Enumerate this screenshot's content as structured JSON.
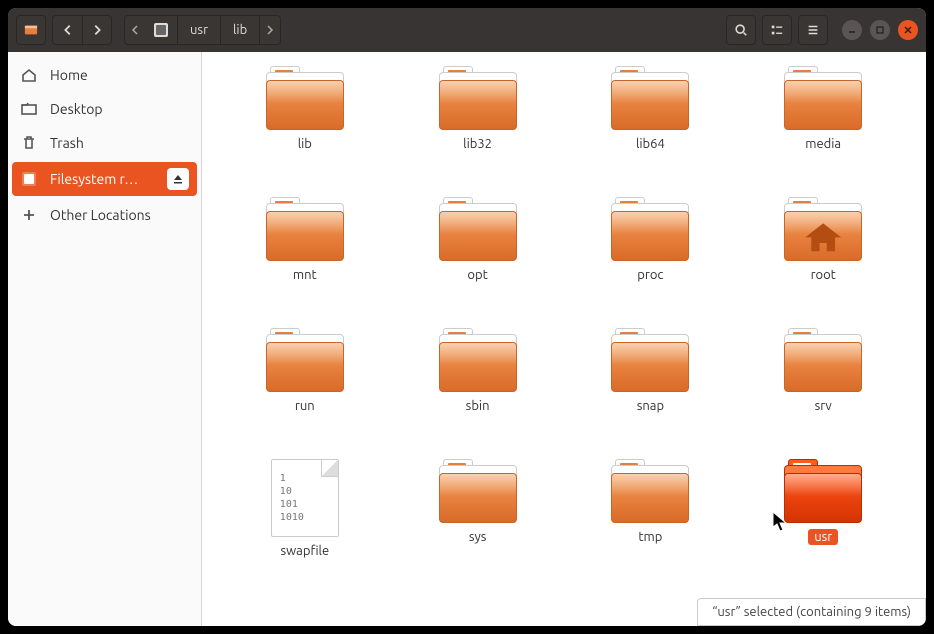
{
  "pathbar": {
    "segments": [
      "usr",
      "lib"
    ]
  },
  "sidebar": {
    "home": "Home",
    "desktop": "Desktop",
    "trash": "Trash",
    "filesystem": "Filesystem r…",
    "other": "Other Locations"
  },
  "items": [
    {
      "name": "lib",
      "type": "folder"
    },
    {
      "name": "lib32",
      "type": "folder"
    },
    {
      "name": "lib64",
      "type": "folder"
    },
    {
      "name": "media",
      "type": "folder"
    },
    {
      "name": "mnt",
      "type": "folder"
    },
    {
      "name": "opt",
      "type": "folder"
    },
    {
      "name": "proc",
      "type": "folder"
    },
    {
      "name": "root",
      "type": "folder-home"
    },
    {
      "name": "run",
      "type": "folder"
    },
    {
      "name": "sbin",
      "type": "folder"
    },
    {
      "name": "snap",
      "type": "folder"
    },
    {
      "name": "srv",
      "type": "folder"
    },
    {
      "name": "swapfile",
      "type": "file",
      "file_preview": "1\n10\n101\n1010"
    },
    {
      "name": "sys",
      "type": "folder"
    },
    {
      "name": "tmp",
      "type": "folder"
    },
    {
      "name": "usr",
      "type": "folder",
      "selected": true
    }
  ],
  "status": "“usr” selected (containing 9 items)"
}
